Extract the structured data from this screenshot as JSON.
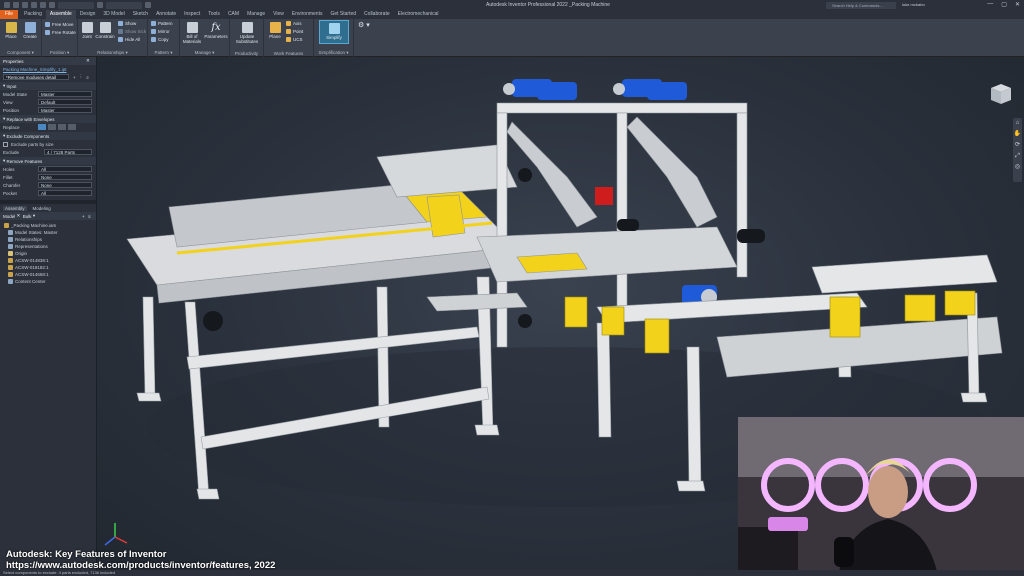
{
  "window": {
    "title": "Autodesk Inventor Professional 2022   _Packing Machine",
    "search_placeholder": "Search Help & Commands...",
    "user": "luke.mcbabo",
    "controls": [
      "—",
      "▢",
      "✕"
    ]
  },
  "tabs": [
    "File",
    "Packing",
    "Assemble",
    "Design",
    "3D Model",
    "Sketch",
    "Annotate",
    "Inspect",
    "Tools",
    "CAM",
    "Manage",
    "View",
    "Environments",
    "Get Started",
    "Collaborate",
    "Electromechanical"
  ],
  "active_tab": "Assemble",
  "ribbon": {
    "groups": [
      {
        "label": "Component ▾",
        "buttons": [
          "Place",
          "Create"
        ],
        "small": []
      },
      {
        "label": "Position ▾",
        "buttons": [],
        "small": [
          "Free Move",
          "Free Rotate"
        ]
      },
      {
        "label": "Relationships ▾",
        "buttons": [
          "Joint",
          "Constrain"
        ],
        "small": [
          "Show",
          "Show Sick",
          "Hide All"
        ]
      },
      {
        "label": "Pattern ▾",
        "buttons": [],
        "small": [
          "Pattern",
          "Mirror",
          "Copy"
        ]
      },
      {
        "label": "Manage ▾",
        "buttons": [
          "Bill of Materials",
          "Parameters"
        ],
        "small": []
      },
      {
        "label": "Productivity",
        "buttons": [
          "Update Substitutes"
        ],
        "small": []
      },
      {
        "label": "Work Features",
        "buttons": [
          "Plane"
        ],
        "small": [
          "Axis",
          "Point",
          "UCS"
        ]
      },
      {
        "label": "Simplification ▾",
        "buttons": [
          "Simplify"
        ],
        "small": []
      }
    ]
  },
  "properties": {
    "panel_title": "Properties",
    "document": "Packing Machine_Simplify_1.ipt",
    "dropdown": "*Remove moduses detail",
    "input_section": "Input",
    "rows": [
      {
        "label": "Model State",
        "value": "Master"
      },
      {
        "label": "View",
        "value": "Default"
      },
      {
        "label": "Position",
        "value": "Master"
      }
    ],
    "envelopes_section": "Replace with Envelopes",
    "envelope_label": "Replace",
    "exclude_section": "Exclude Components",
    "exclude_checkbox": "Exclude parts by size",
    "exclude_label": "Exclude",
    "exclude_value": "4 / 7128 Parts",
    "remove_section": "Remove Features",
    "remove_rows": [
      {
        "label": "Holes",
        "value": "All"
      },
      {
        "label": "Fillet",
        "value": "None"
      },
      {
        "label": "Chamfer",
        "value": "None"
      },
      {
        "label": "Pocket",
        "value": "All"
      }
    ]
  },
  "browser": {
    "tabs": [
      "Assembly",
      "Modeling"
    ],
    "header": [
      "Model",
      "Bulk"
    ],
    "items": [
      "_Packing Machine.iam",
      "Model States: Master",
      "Relationships",
      "Representations",
      "Origin",
      "ACSW-014838:1",
      "ACSW-018182:1",
      "ACSW-014668:1",
      "Content Center"
    ]
  },
  "caption": {
    "line1": "Autodesk: Key Features of Inventor",
    "line2": "https://www.autodesk.com/products/inventor/features, 2022"
  },
  "status": "Select components to exclude: 4 parts excluded, 7136 included",
  "colors": {
    "accent": "#e0621c",
    "frame": "#e4e6e8",
    "motor": "#1f5bd8",
    "yellow": "#f2d21a",
    "background": "#2a313c"
  }
}
